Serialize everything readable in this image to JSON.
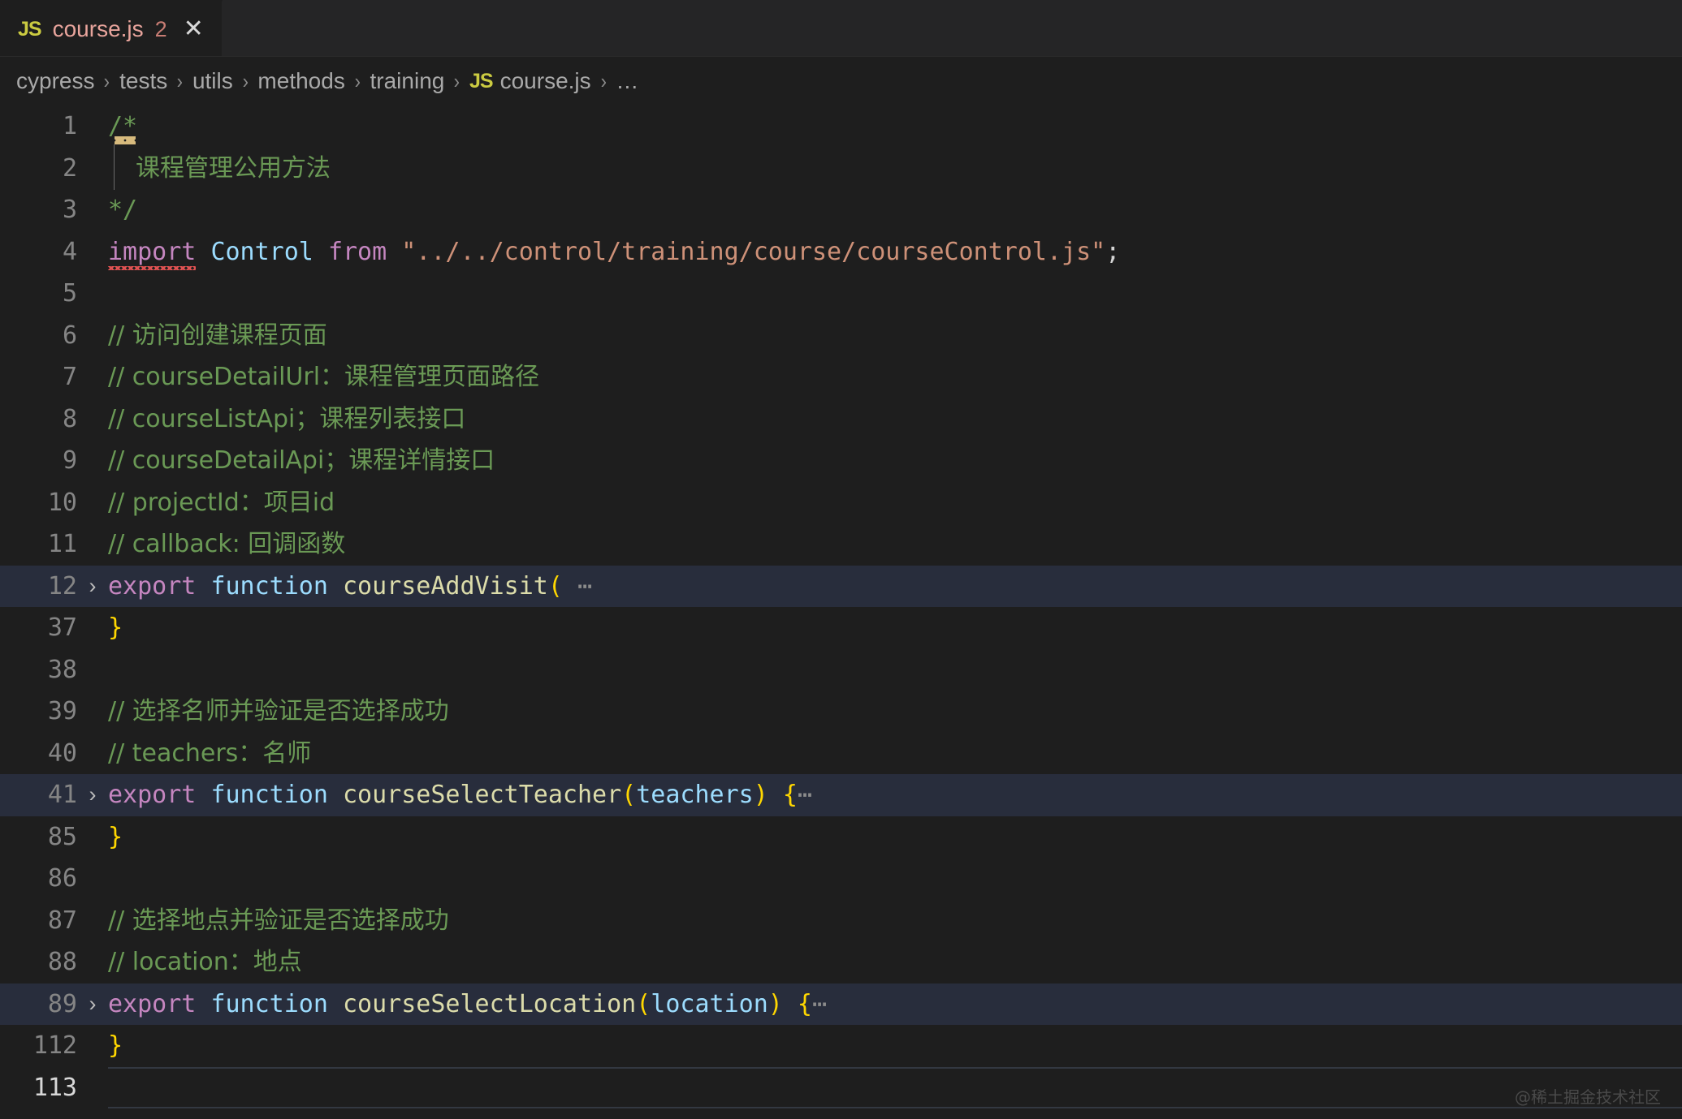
{
  "tab": {
    "icon": "js-file-icon",
    "filename": "course.js",
    "problem_count": "2",
    "close_glyph": "✕"
  },
  "breadcrumb": {
    "separator": "›",
    "items": [
      "cypress",
      "tests",
      "utils",
      "methods",
      "training"
    ],
    "file_icon": "JS",
    "file": "course.js",
    "overflow": "…"
  },
  "colors": {
    "editor_background": "#1e1e1e",
    "tabbar_background": "#252526",
    "line_highlight": "#282d3c",
    "comment": "#6a9955",
    "keyword": "#c586c0",
    "string": "#ce9178",
    "function": "#dcdcaa",
    "variable": "#9cdcfe",
    "bracket_yellow": "#ffd700",
    "line_number": "#858585",
    "js_icon": "#cbcb41",
    "tab_label": "#e8a49c"
  },
  "lines": [
    {
      "num": "1",
      "fold": "",
      "highlight": false
    },
    {
      "num": "2",
      "fold": "",
      "highlight": false
    },
    {
      "num": "3",
      "fold": "",
      "highlight": false
    },
    {
      "num": "4",
      "fold": "",
      "highlight": false
    },
    {
      "num": "5",
      "fold": "",
      "highlight": false
    },
    {
      "num": "6",
      "fold": "",
      "highlight": false
    },
    {
      "num": "7",
      "fold": "",
      "highlight": false
    },
    {
      "num": "8",
      "fold": "",
      "highlight": false
    },
    {
      "num": "9",
      "fold": "",
      "highlight": false
    },
    {
      "num": "10",
      "fold": "",
      "highlight": false
    },
    {
      "num": "11",
      "fold": "",
      "highlight": false
    },
    {
      "num": "12",
      "fold": "›",
      "highlight": true
    },
    {
      "num": "37",
      "fold": "",
      "highlight": false
    },
    {
      "num": "38",
      "fold": "",
      "highlight": false
    },
    {
      "num": "39",
      "fold": "",
      "highlight": false
    },
    {
      "num": "40",
      "fold": "",
      "highlight": false
    },
    {
      "num": "41",
      "fold": "›",
      "highlight": true
    },
    {
      "num": "85",
      "fold": "",
      "highlight": false
    },
    {
      "num": "86",
      "fold": "",
      "highlight": false
    },
    {
      "num": "87",
      "fold": "",
      "highlight": false
    },
    {
      "num": "88",
      "fold": "",
      "highlight": false
    },
    {
      "num": "89",
      "fold": "›",
      "highlight": true
    },
    {
      "num": "112",
      "fold": "",
      "highlight": false
    },
    {
      "num": "113",
      "fold": "",
      "highlight": false
    }
  ],
  "code": {
    "l1_comment": "/*",
    "l2_comment": "课程管理公用方法",
    "l3_comment": "*/",
    "l4_import": "import",
    "l4_binding": "Control",
    "l4_from": "from",
    "l4_module": "\"../../control/training/course/courseControl.js\"",
    "l4_semi": ";",
    "l6_comment": "// 访问创建课程页面",
    "l7_comment": "// courseDetailUrl：课程管理页面路径",
    "l8_comment": "// courseListApi；课程列表接口",
    "l9_comment": "// courseDetailApi；课程详情接口",
    "l10_comment": "// projectId：项目id",
    "l11_comment": "// callback: 回调函数",
    "l12_export": "export",
    "l12_function": "function",
    "l12_name": "courseAddVisit",
    "l12_paren": "(",
    "l12_fold": "⋯",
    "l37_brace": "}",
    "l39_comment": "// 选择名师并验证是否选择成功",
    "l40_comment": "// teachers：名师",
    "l41_export": "export",
    "l41_function": "function",
    "l41_name": "courseSelectTeacher",
    "l41_open_paren": "(",
    "l41_param": "teachers",
    "l41_close_paren": ")",
    "l41_brace": "{",
    "l41_fold": "⋯",
    "l85_brace": "}",
    "l87_comment": "// 选择地点并验证是否选择成功",
    "l88_comment": "// location：地点",
    "l89_export": "export",
    "l89_function": "function",
    "l89_name": "courseSelectLocation",
    "l89_open_paren": "(",
    "l89_param": "location",
    "l89_close_paren": ")",
    "l89_brace": "{",
    "l89_fold": "⋯",
    "l112_brace": "}"
  },
  "watermark": "@稀土掘金技术社区"
}
